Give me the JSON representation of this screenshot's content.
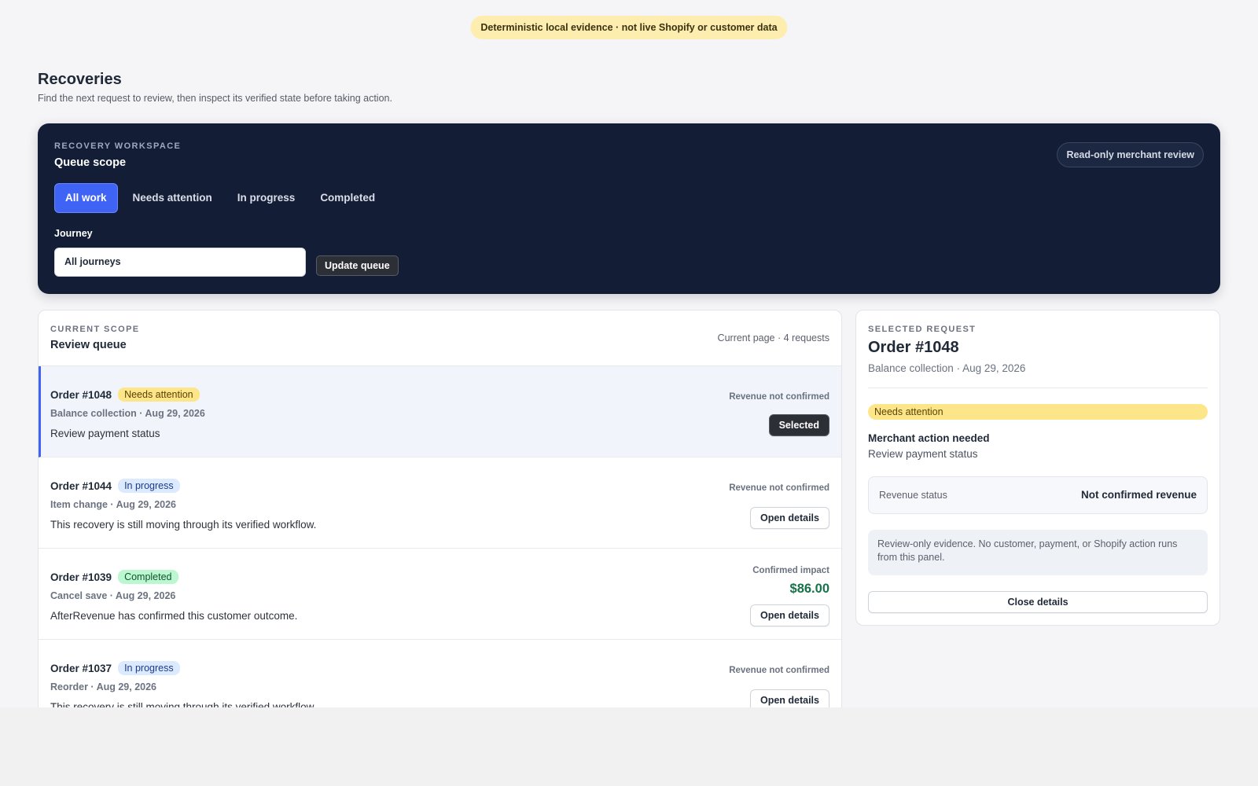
{
  "banner": "Deterministic local evidence · not live Shopify or customer data",
  "header": {
    "title": "Recoveries",
    "subtitle": "Find the next request to review, then inspect its verified state before taking action."
  },
  "workspace": {
    "eyebrow": "RECOVERY WORKSPACE",
    "title": "Queue scope",
    "badge": "Read-only merchant review",
    "tabs": [
      {
        "label": "All work"
      },
      {
        "label": "Needs attention"
      },
      {
        "label": "In progress"
      },
      {
        "label": "Completed"
      }
    ],
    "journey_label": "Journey",
    "journey_value": "All journeys",
    "update_label": "Update queue"
  },
  "queue": {
    "eyebrow": "CURRENT SCOPE",
    "title": "Review queue",
    "count": "Current page · 4 requests",
    "rows": [
      {
        "order": "Order #1048",
        "status": "Needs attention",
        "meta": "Balance collection · Aug 29, 2026",
        "desc": "Review payment status",
        "revenue": "Revenue not confirmed",
        "button": "Selected"
      },
      {
        "order": "Order #1044",
        "status": "In progress",
        "meta": "Item change · Aug 29, 2026",
        "desc": "This recovery is still moving through its verified workflow.",
        "revenue": "Revenue not confirmed",
        "button": "Open details"
      },
      {
        "order": "Order #1039",
        "status": "Completed",
        "meta": "Cancel save · Aug 29, 2026",
        "desc": "AfterRevenue has confirmed this customer outcome.",
        "revenue": "Confirmed impact",
        "amount": "$86.00",
        "button": "Open details"
      },
      {
        "order": "Order #1037",
        "status": "In progress",
        "meta": "Reorder · Aug 29, 2026",
        "desc": "This recovery is still moving through its verified workflow.",
        "revenue": "Revenue not confirmed",
        "button": "Open details"
      }
    ]
  },
  "detail": {
    "eyebrow": "SELECTED REQUEST",
    "title": "Order #1048",
    "meta": "Balance collection · Aug 29, 2026",
    "status": "Needs attention",
    "action_title": "Merchant action needed",
    "action_desc": "Review payment status",
    "revenue_label": "Revenue status",
    "revenue_value": "Not confirmed revenue",
    "note": "Review-only evidence. No customer, payment, or Shopify action runs from this panel.",
    "close_label": "Close details"
  }
}
